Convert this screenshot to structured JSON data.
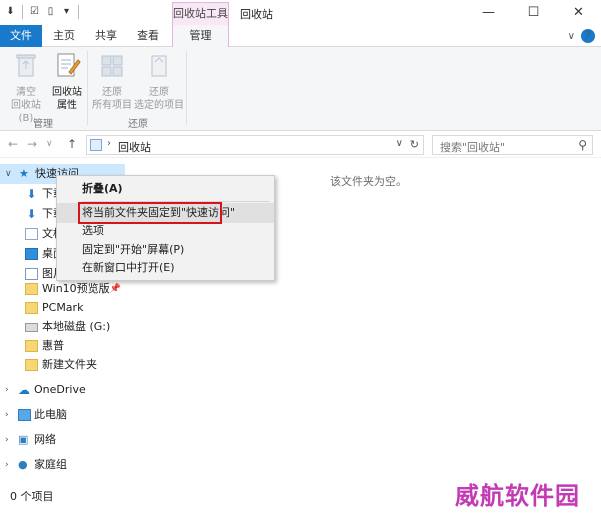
{
  "titlebar": {
    "qat_icons": [
      "down-arrow-icon",
      "check-icon",
      "page-icon",
      "dropdown-icon"
    ],
    "context_tab": "回收站工具",
    "window_title": "回收站",
    "controls": {
      "minimize": "—",
      "maximize": "☐",
      "close": "✕"
    }
  },
  "tabs": {
    "file": "文件",
    "home": "主页",
    "share": "共享",
    "view": "查看",
    "manage": "管理",
    "collapse": "∨",
    "help": "?"
  },
  "ribbon": {
    "buttons": [
      {
        "line1": "清空",
        "line2": "回收站(B)",
        "enabled": false
      },
      {
        "line1": "回收站",
        "line2": "属性",
        "enabled": true
      },
      {
        "line1": "还原",
        "line2": "所有项目",
        "enabled": false
      },
      {
        "line1": "还原",
        "line2": "选定的项目",
        "enabled": false
      }
    ],
    "groups": [
      "管理",
      "还原"
    ]
  },
  "addressbar": {
    "back": "←",
    "forward": "→",
    "recent": "∨",
    "up": "↑",
    "chevron": "›",
    "location": "回收站",
    "dropdown": "∨",
    "refresh": "↻",
    "search_placeholder": "搜索\"回收站\"",
    "search_icon": "⚲"
  },
  "navpane": {
    "items": [
      {
        "label": "快速访问",
        "expand": "∨"
      },
      {
        "label": "下载"
      },
      {
        "label": "下载"
      },
      {
        "label": "文档"
      },
      {
        "label": "桌面"
      },
      {
        "label": "图片"
      },
      {
        "label": "Win10预览版",
        "pin": "📌"
      },
      {
        "label": "PCMark"
      },
      {
        "label": "本地磁盘 (G:)"
      },
      {
        "label": "惠普"
      },
      {
        "label": "新建文件夹"
      },
      {
        "label": "OneDrive",
        "expand": "›"
      },
      {
        "label": "此电脑",
        "expand": "›"
      },
      {
        "label": "网络",
        "expand": "›"
      },
      {
        "label": "家庭组",
        "expand": "›"
      }
    ]
  },
  "content": {
    "empty_message": "该文件夹为空。"
  },
  "statusbar": {
    "count": "0 个项目"
  },
  "watermark": "威航软件园",
  "context_menu": {
    "items": [
      "折叠(A)",
      "将当前文件夹固定到\"快速访问\"",
      "选项",
      "固定到\"开始\"屏幕(P)",
      "在新窗口中打开(E)"
    ]
  },
  "colors": {
    "accent": "#1979ca",
    "highlight_box": "#d6141b",
    "watermark": "#c23bb4",
    "selection": "#cce8ff"
  }
}
